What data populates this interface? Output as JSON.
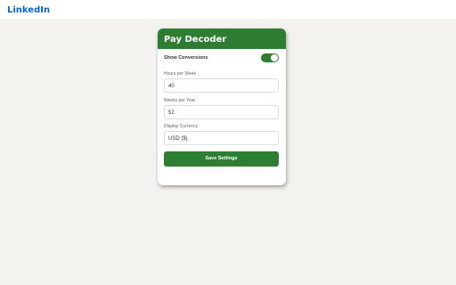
{
  "page": {
    "brand": "LinkedIn"
  },
  "popup": {
    "title": "Pay Decoder",
    "show_conversions": {
      "label": "Show Conversions",
      "enabled": true
    },
    "hours_per_week": {
      "label": "Hours per Week",
      "value": "40"
    },
    "weeks_per_year": {
      "label": "Weeks per Year",
      "value": "52"
    },
    "display_currency": {
      "label": "Display Currency",
      "value": "USD ($)"
    },
    "save_label": "Save Settings"
  },
  "colors": {
    "accent": "#2e7d32",
    "brand": "#0a66c2",
    "background": "#f3f2ef"
  }
}
